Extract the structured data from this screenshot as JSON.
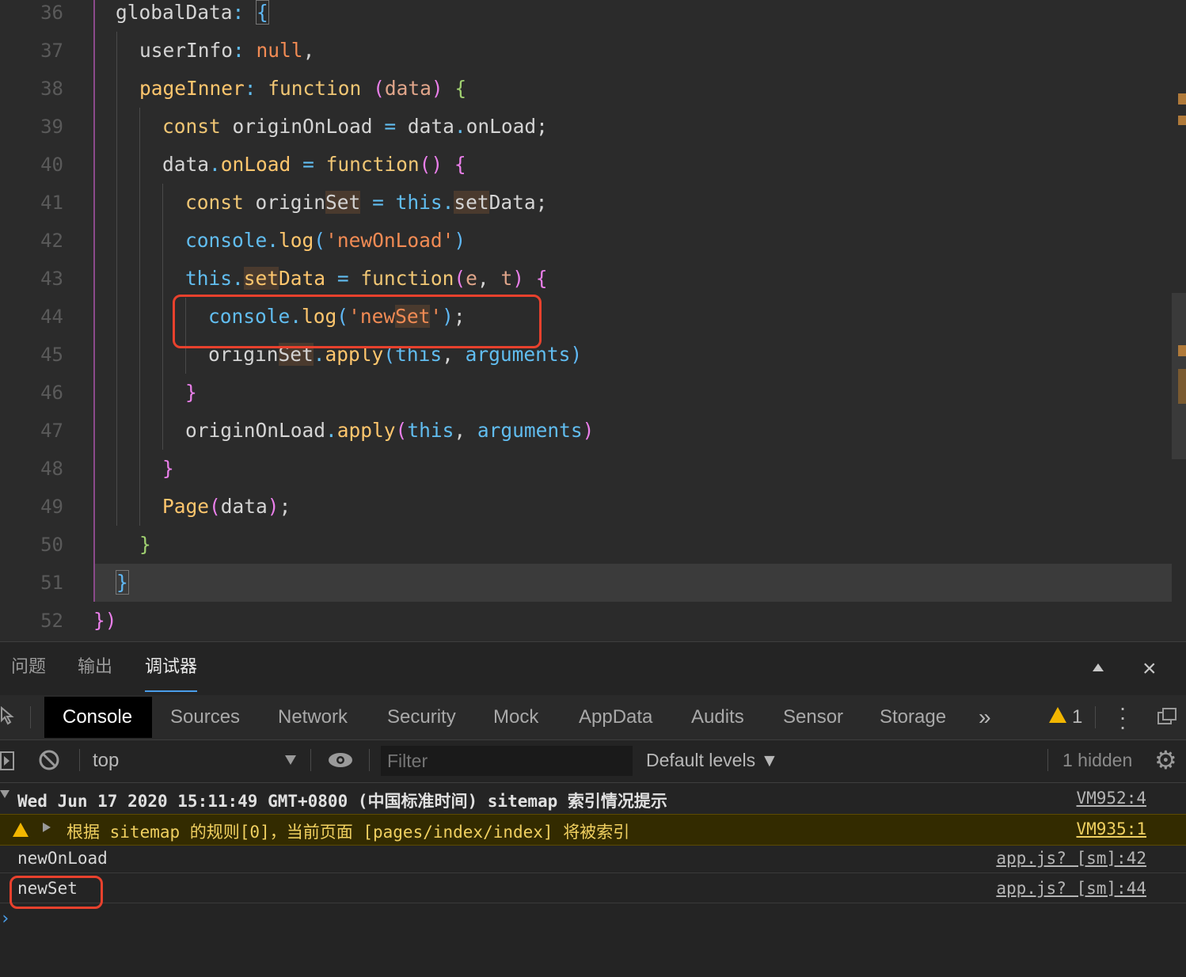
{
  "editor": {
    "line_numbers": [
      "36",
      "37",
      "38",
      "39",
      "40",
      "41",
      "42",
      "43",
      "44",
      "45",
      "46",
      "47",
      "48",
      "49",
      "50",
      "51",
      "52"
    ],
    "lines": {
      "l36": {
        "a": "globalData",
        "b": ":",
        "c": "{"
      },
      "l37": {
        "a": "userInfo",
        "b": ":",
        "c": "null",
        "d": ","
      },
      "l38": {
        "a": "pageInner",
        "b": ":",
        "c": "function",
        "d": "(",
        "e": "data",
        "f": ")",
        "g": "{"
      },
      "l39": {
        "a": "const",
        "b": "originOnLoad",
        "c": "=",
        "d": "data",
        "e": ".",
        "f": "onLoad",
        "g": ";"
      },
      "l40": {
        "a": "data",
        "b": ".",
        "c": "onLoad",
        "d": "=",
        "e": "function",
        "f": "()",
        "g": "{"
      },
      "l41": {
        "a": "const",
        "b": "origin",
        "c": "Set",
        "d": "=",
        "e": "this",
        "f": ".",
        "g": "set",
        "h": "Data",
        "i": ";"
      },
      "l42": {
        "a": "console",
        "b": ".",
        "c": "log",
        "d": "(",
        "e": "'newOnLoad'",
        "f": ")"
      },
      "l43": {
        "a": "this",
        "b": ".",
        "c": "set",
        "d": "Data",
        "e": "=",
        "f": "function",
        "g": "(",
        "h": "e",
        "i": ",",
        "j": "t",
        "k": ")",
        "l": "{"
      },
      "l44": {
        "a": "console",
        "b": ".",
        "c": "log",
        "d": "(",
        "e": "'new",
        "f": "Set",
        "g": "'",
        "h": ")",
        "i": ";"
      },
      "l45": {
        "a": "origin",
        "b": "Set",
        "c": ".",
        "d": "apply",
        "e": "(",
        "f": "this",
        "g": ",",
        "h": "arguments",
        "i": ")"
      },
      "l46": {
        "a": "}"
      },
      "l47": {
        "a": "originOnLoad",
        "b": ".",
        "c": "apply",
        "d": "(",
        "e": "this",
        "f": ",",
        "g": "arguments",
        "h": ")"
      },
      "l48": {
        "a": "}"
      },
      "l49": {
        "a": "Page",
        "b": "(",
        "c": "data",
        "d": ")",
        "e": ";"
      },
      "l50": {
        "a": "}"
      },
      "l51": {
        "a": "}"
      },
      "l52": {
        "a": "})"
      }
    }
  },
  "panel_tabs": [
    "问题",
    "输出",
    "调试器"
  ],
  "devtools": {
    "tabs": [
      "Console",
      "Sources",
      "Network",
      "Security",
      "Mock",
      "AppData",
      "Audits",
      "Sensor",
      "Storage"
    ],
    "more": "»",
    "warning_count": "1",
    "context": "top",
    "filter_placeholder": "Filter",
    "levels": "Default levels ▼",
    "hidden": "1 hidden"
  },
  "console": {
    "group": {
      "text": "Wed Jun 17 2020 15:11:49 GMT+0800 (中国标准时间) sitemap 索引情况提示",
      "link": "VM952:4"
    },
    "warning": {
      "text": "根据 sitemap 的规则[0]，当前页面 [pages/index/index] 将被索引",
      "link": "VM935:1"
    },
    "logs": [
      {
        "text": "newOnLoad",
        "link": "app.js? [sm]:42"
      },
      {
        "text": "newSet",
        "link": "app.js? [sm]:44"
      }
    ],
    "prompt": "›"
  },
  "colors": {
    "editor_bg": "#2b2b2b",
    "panel_bg": "#242424",
    "highlight_red": "#e8412d",
    "warning_bg": "#332b00"
  }
}
